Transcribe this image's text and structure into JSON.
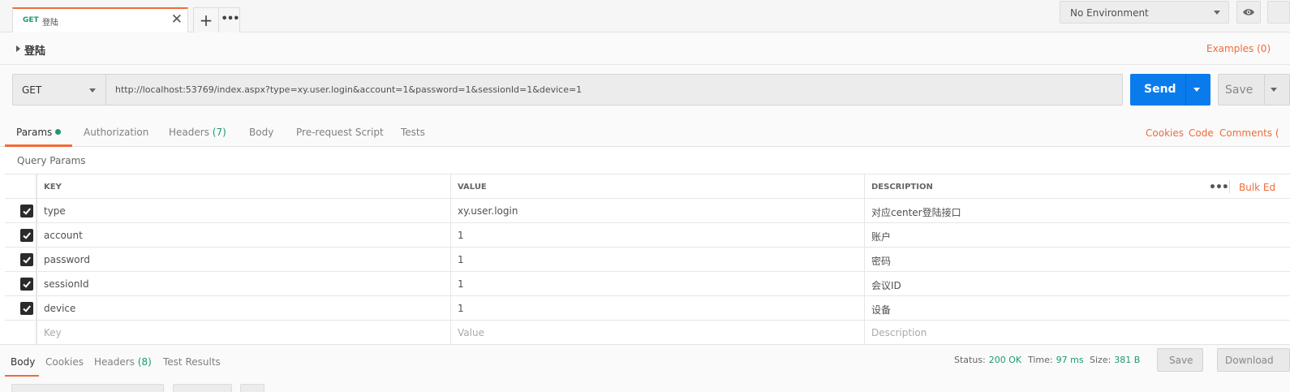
{
  "tabbar": {
    "tab": {
      "method": "GET",
      "name": "登陆",
      "close_glyph": "✕"
    },
    "add_glyph": "+",
    "more_glyph": "•••"
  },
  "environment": {
    "selected": "No Environment"
  },
  "breadcrumb": {
    "title": "登陆",
    "examples": "Examples (0)"
  },
  "request": {
    "method": "GET",
    "url": "http://localhost:53769/index.aspx?type=xy.user.login&account=1&password=1&sessionId=1&device=1",
    "send_label": "Send",
    "save_label": "Save"
  },
  "request_tabs": {
    "params": "Params",
    "authorization": "Authorization",
    "headers": "Headers",
    "headers_count": "(7)",
    "body": "Body",
    "prerequest": "Pre-request Script",
    "tests": "Tests",
    "cookies": "Cookies",
    "code": "Code",
    "comments": "Comments ("
  },
  "query_params": {
    "title": "Query Params",
    "columns": {
      "key": "KEY",
      "value": "VALUE",
      "description": "DESCRIPTION"
    },
    "bulk_edit": "Bulk Ed",
    "rows": [
      {
        "key": "type",
        "value": "xy.user.login",
        "description": "对应center登陆接口",
        "checked": true
      },
      {
        "key": "account",
        "value": "1",
        "description": "账户",
        "checked": true
      },
      {
        "key": "password",
        "value": "1",
        "description": "密码",
        "checked": true
      },
      {
        "key": "sessionId",
        "value": "1",
        "description": "会议ID",
        "checked": true
      },
      {
        "key": "device",
        "value": "1",
        "description": "设备",
        "checked": true
      }
    ],
    "placeholders": {
      "key": "Key",
      "value": "Value",
      "description": "Description"
    }
  },
  "response": {
    "tabs": {
      "body": "Body",
      "cookies": "Cookies",
      "headers": "Headers",
      "headers_count": "(8)",
      "test_results": "Test Results"
    },
    "status_label": "Status:",
    "status_value": "200 OK",
    "time_label": "Time:",
    "time_value": "97 ms",
    "size_label": "Size:",
    "size_value": "381 B",
    "save_label": "Save",
    "download_label": "Download"
  },
  "colors": {
    "accent": "#f26b3a",
    "send_blue": "#097bed",
    "success_green": "#1c9a6a"
  }
}
